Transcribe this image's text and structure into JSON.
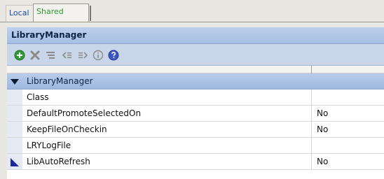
{
  "tabs": [
    {
      "label": "Local",
      "selected": false
    },
    {
      "label": "Shared",
      "selected": true
    }
  ],
  "panel": {
    "title": "LibraryManager"
  },
  "toolbar": {
    "buttons": [
      {
        "icon": "add-icon",
        "color": "#2e9d33"
      },
      {
        "icon": "delete-icon",
        "color": "#8a8a8a"
      },
      {
        "icon": "sort-icon",
        "color": "#8a8a8a"
      },
      {
        "icon": "outdent-icon",
        "color": "#8a8a8a"
      },
      {
        "icon": "indent-icon",
        "color": "#8a8a8a"
      },
      {
        "icon": "info-icon",
        "color": "#8a8a8a"
      },
      {
        "icon": "help-icon",
        "color": "#3a55c8"
      }
    ]
  },
  "grid": {
    "category": {
      "label": "LibraryManager",
      "expanded": true
    },
    "rows": [
      {
        "name": "Class",
        "value": ""
      },
      {
        "name": "DefaultPromoteSelectedOn",
        "value": "No"
      },
      {
        "name": "KeepFileOnCheckin",
        "value": "No"
      },
      {
        "name": "LRYLogFile",
        "value": ""
      },
      {
        "name": "LibAutoRefresh",
        "value": "No"
      }
    ]
  },
  "colors": {
    "title_bar": "#a7bfe2",
    "toolbar": "#c9d6ea",
    "tab_local_text": "#1a4bb0",
    "tab_shared_text": "#2f9a2f"
  }
}
